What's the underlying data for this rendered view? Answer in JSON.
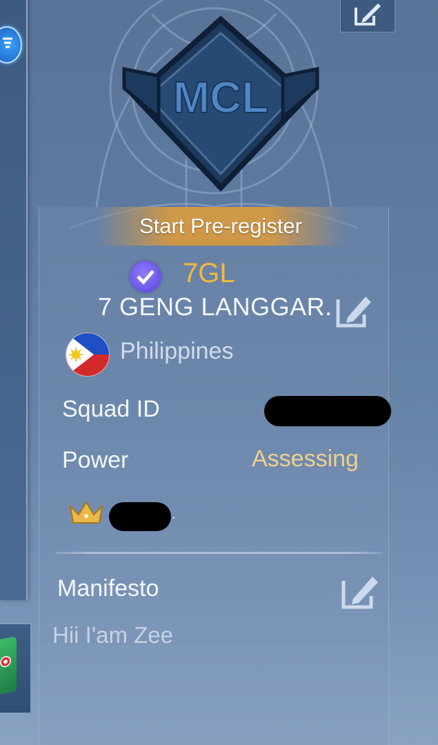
{
  "emblem": {
    "text": "MCL"
  },
  "prereg": {
    "label": "Start Pre-register"
  },
  "squad": {
    "tag": "7GL",
    "name": "7 GENG LANGGAR.",
    "country": "Philippines"
  },
  "info": {
    "squad_id_label": "Squad ID",
    "power_label": "Power",
    "power_value": "Assessing"
  },
  "leader": {
    "suffix": "."
  },
  "manifesto": {
    "label": "Manifesto",
    "text": "Hii I'am Zee"
  },
  "colors": {
    "tag": "#f2b83d",
    "power_value": "#f1cf8f",
    "prereg_bar": "#e19b37",
    "verify_badge": "#6a55e6"
  },
  "icons": [
    "filter-icon",
    "edit-icon",
    "verified-icon",
    "philippines-flag-icon",
    "crown-icon"
  ]
}
